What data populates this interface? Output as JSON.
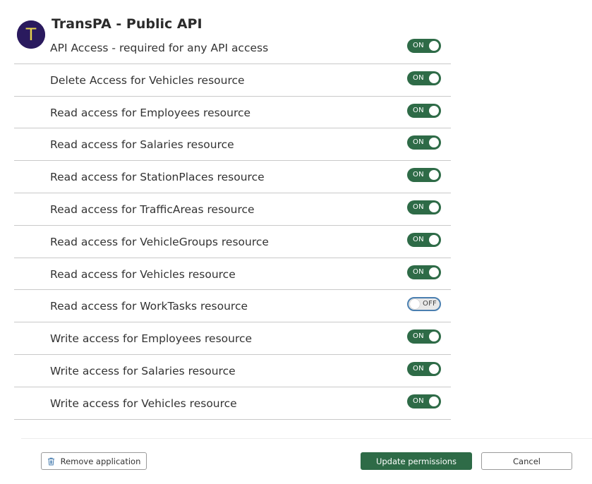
{
  "app": {
    "avatar_letter": "T",
    "title": "TransPA - Public API"
  },
  "permissions": [
    {
      "label": "API Access - required for any API access",
      "state": "ON"
    },
    {
      "label": "Delete Access for Vehicles resource",
      "state": "ON"
    },
    {
      "label": "Read access for Employees resource",
      "state": "ON"
    },
    {
      "label": "Read access for Salaries resource",
      "state": "ON"
    },
    {
      "label": "Read access for StationPlaces resource",
      "state": "ON"
    },
    {
      "label": "Read access for TrafficAreas resource",
      "state": "ON"
    },
    {
      "label": "Read access for VehicleGroups resource",
      "state": "ON"
    },
    {
      "label": "Read access for Vehicles resource",
      "state": "ON"
    },
    {
      "label": "Read access for WorkTasks resource",
      "state": "OFF"
    },
    {
      "label": "Write access for Employees resource",
      "state": "ON"
    },
    {
      "label": "Write access for Salaries resource",
      "state": "ON"
    },
    {
      "label": "Write access for Vehicles resource",
      "state": "ON"
    }
  ],
  "footer": {
    "remove_label": "Remove application",
    "update_label": "Update permissions",
    "cancel_label": "Cancel"
  },
  "colors": {
    "accent_green": "#2e6b47",
    "avatar_bg": "#2a1a5e",
    "avatar_letter": "#e8d44d",
    "off_focus_border": "#4a7fb0"
  },
  "icons": {
    "remove": "trash-icon"
  }
}
